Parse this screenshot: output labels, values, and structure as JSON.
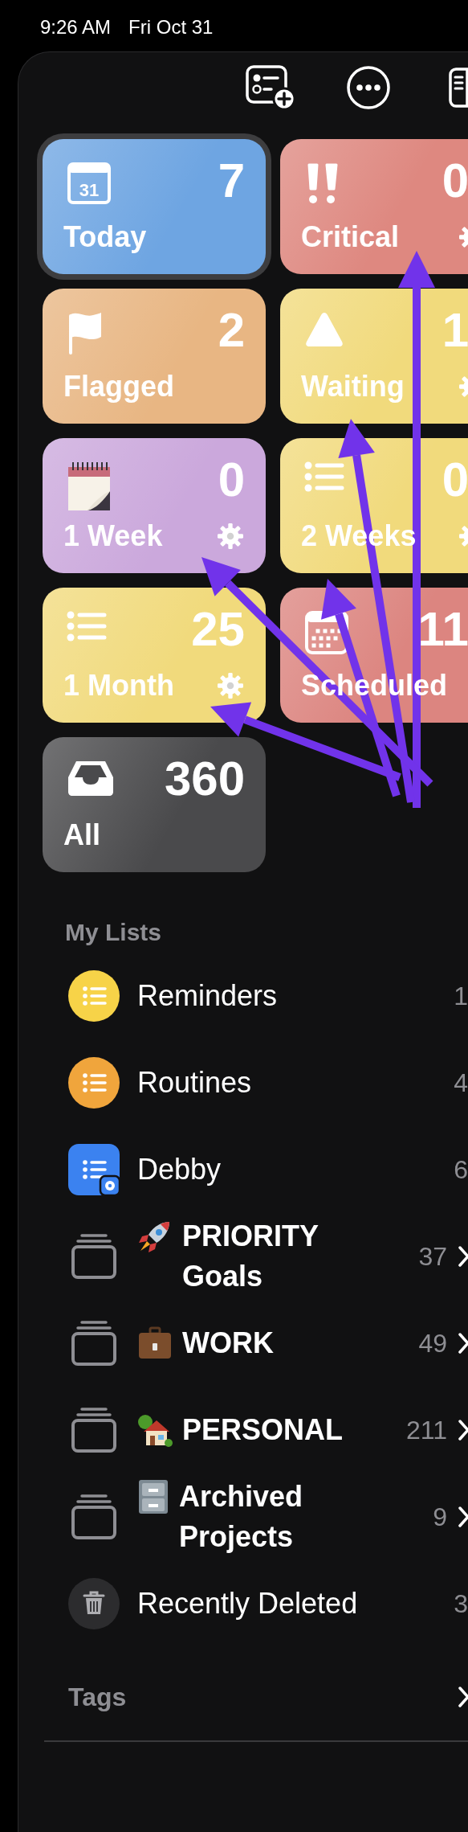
{
  "status_bar": {
    "time": "9:26 AM",
    "date": "Fri Oct 31"
  },
  "toolbar": [
    {
      "kind": "add-list"
    },
    {
      "kind": "more"
    },
    {
      "kind": "sidebar"
    }
  ],
  "smart_lists": [
    {
      "label": "Today",
      "count": "7",
      "icon_label": "31",
      "color": "#6ea5e2",
      "selected": true,
      "settings": false
    },
    {
      "label": "Critical",
      "count": "0",
      "color": "#de8880",
      "selected": false,
      "settings": true
    },
    {
      "label": "Flagged",
      "count": "2",
      "color": "#e8b683",
      "selected": false,
      "settings": false
    },
    {
      "label": "Waiting",
      "count": "1",
      "color": "#f1da7c",
      "selected": false,
      "settings": true
    },
    {
      "label": "1 Week",
      "count": "0",
      "color": "#cba8dc",
      "selected": false,
      "settings": true
    },
    {
      "label": "2 Weeks",
      "count": "0",
      "color": "#f1da7c",
      "selected": false,
      "settings": true
    },
    {
      "label": "1 Month",
      "count": "25",
      "color": "#f1da7c",
      "selected": false,
      "settings": true
    },
    {
      "label": "Scheduled",
      "count": "11",
      "color": "#dc8580",
      "selected": false,
      "settings": false
    },
    {
      "label": "All",
      "count": "360",
      "color": "#4a4a4c",
      "selected": false,
      "settings": false
    }
  ],
  "my_lists": {
    "title": "My Lists",
    "items": [
      {
        "kind": "list",
        "color": "#f7d348",
        "name": "Reminders",
        "count": "1",
        "chevron": false
      },
      {
        "kind": "list",
        "color": "#f0a53c",
        "name": "Routines",
        "count": "4",
        "chevron": false
      },
      {
        "kind": "shared",
        "color": "#3b82f0",
        "name": "Debby",
        "count": "6",
        "chevron": false
      },
      {
        "kind": "folder",
        "name": "PRIORITY Goals",
        "count": "37",
        "chevron": true
      },
      {
        "kind": "folder",
        "name": "WORK",
        "count": "49",
        "chevron": true
      },
      {
        "kind": "folder",
        "name": "PERSONAL",
        "count": "211",
        "chevron": true
      },
      {
        "kind": "folder",
        "name": "Archived Projects",
        "count": "9",
        "chevron": true
      },
      {
        "kind": "trash",
        "name": "Recently Deleted",
        "count": "3",
        "chevron": false
      }
    ]
  },
  "tags": {
    "title": "Tags",
    "chevron": true
  }
}
